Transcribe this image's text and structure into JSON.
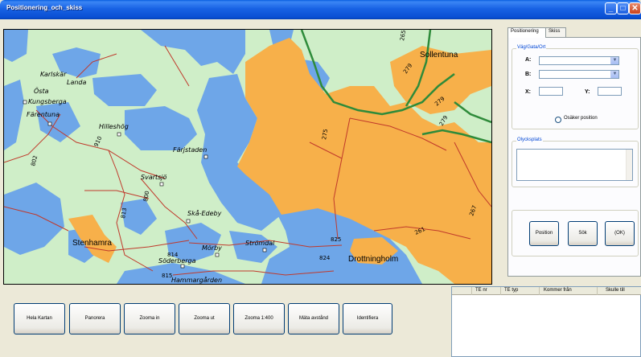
{
  "window": {
    "title": "Positionering_och_skiss"
  },
  "titlebar_buttons": {
    "minimize": "_",
    "maximize": "□",
    "close": "✕"
  },
  "map": {
    "labels": {
      "sollentuna": "Sollentuna",
      "karlskar": "Karlskär",
      "landa": "Landa",
      "osta": "Östa",
      "kungsberga": "Kungsberga",
      "farentuna": "Färentuna",
      "hilleshog": "Hilleshög",
      "farjstaden": "Färjstaden",
      "svartsjo": "Svartsjö",
      "sko_edeby": "Skå-Edeby",
      "stenhamra": "Stenhamra",
      "morby": "Mörby",
      "strondal": "Strömdal",
      "soderberga": "Söderberga",
      "hammargarden": "Hammargården",
      "drottningholm": "Drottningholm"
    },
    "road_numbers": {
      "r265": "265",
      "r279a": "279",
      "r279b": "279",
      "r279c": "279",
      "r275": "275",
      "r261": "261",
      "r267": "267",
      "r910": "910",
      "r800": "800",
      "r802": "802",
      "r813": "813",
      "r814": "814",
      "r825": "825",
      "r824": "824",
      "r815": "815"
    }
  },
  "right_panel": {
    "tabs": [
      "Positionering",
      "Skiss"
    ],
    "vag_group": {
      "label": "Väg/Gata/Ort",
      "a_label": "A:",
      "b_label": "B:",
      "a_value": "",
      "b_value": "",
      "x_label": "X:",
      "y_label": "Y:",
      "x_value": "",
      "y_value": "",
      "osaker_label": "Osäker position"
    },
    "olycksplats_group": {
      "label": "Olycksplats",
      "value": ""
    },
    "buttons": {
      "position": "Position",
      "sok": "Sök",
      "ok": "(OK)"
    }
  },
  "bottom_buttons": {
    "hela_kartan": "Hela Kartan",
    "panorera": "Panorera",
    "zooma_in": "Zooma in",
    "zooma_ut": "Zooma ut",
    "zooma_1400": "Zooma 1:400",
    "mata_avstand": "Mäta avstånd",
    "identifiera": "Identifiera"
  },
  "grid": {
    "columns": [
      "TE nr",
      "TE typ",
      "Kommer från",
      "Skulle till"
    ],
    "rows": []
  },
  "colors": {
    "land": "#cfeec8",
    "water": "#6ea6e8",
    "urban": "#f7b04a",
    "road": "#c0392b",
    "highway": "#2e8b3a"
  }
}
